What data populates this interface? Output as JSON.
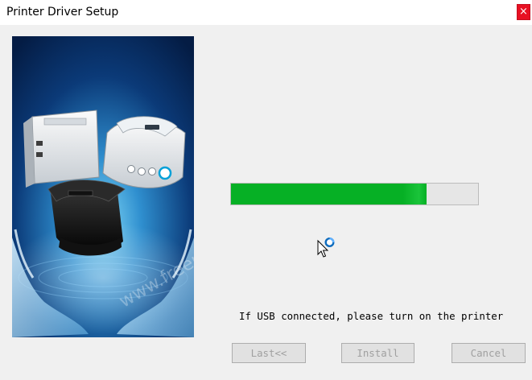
{
  "window": {
    "title": "Printer Driver Setup",
    "close_glyph": "×"
  },
  "image": {
    "semantic": "printers-in-hands-image",
    "watermark": "www.freeprinterdriverdownload.org"
  },
  "progress": {
    "value": 0.79,
    "fill_color": "#06b025"
  },
  "status": {
    "text": "If USB connected, please turn on the printer"
  },
  "buttons": {
    "last": "Last<<",
    "install": "Install",
    "cancel": "Cancel"
  }
}
